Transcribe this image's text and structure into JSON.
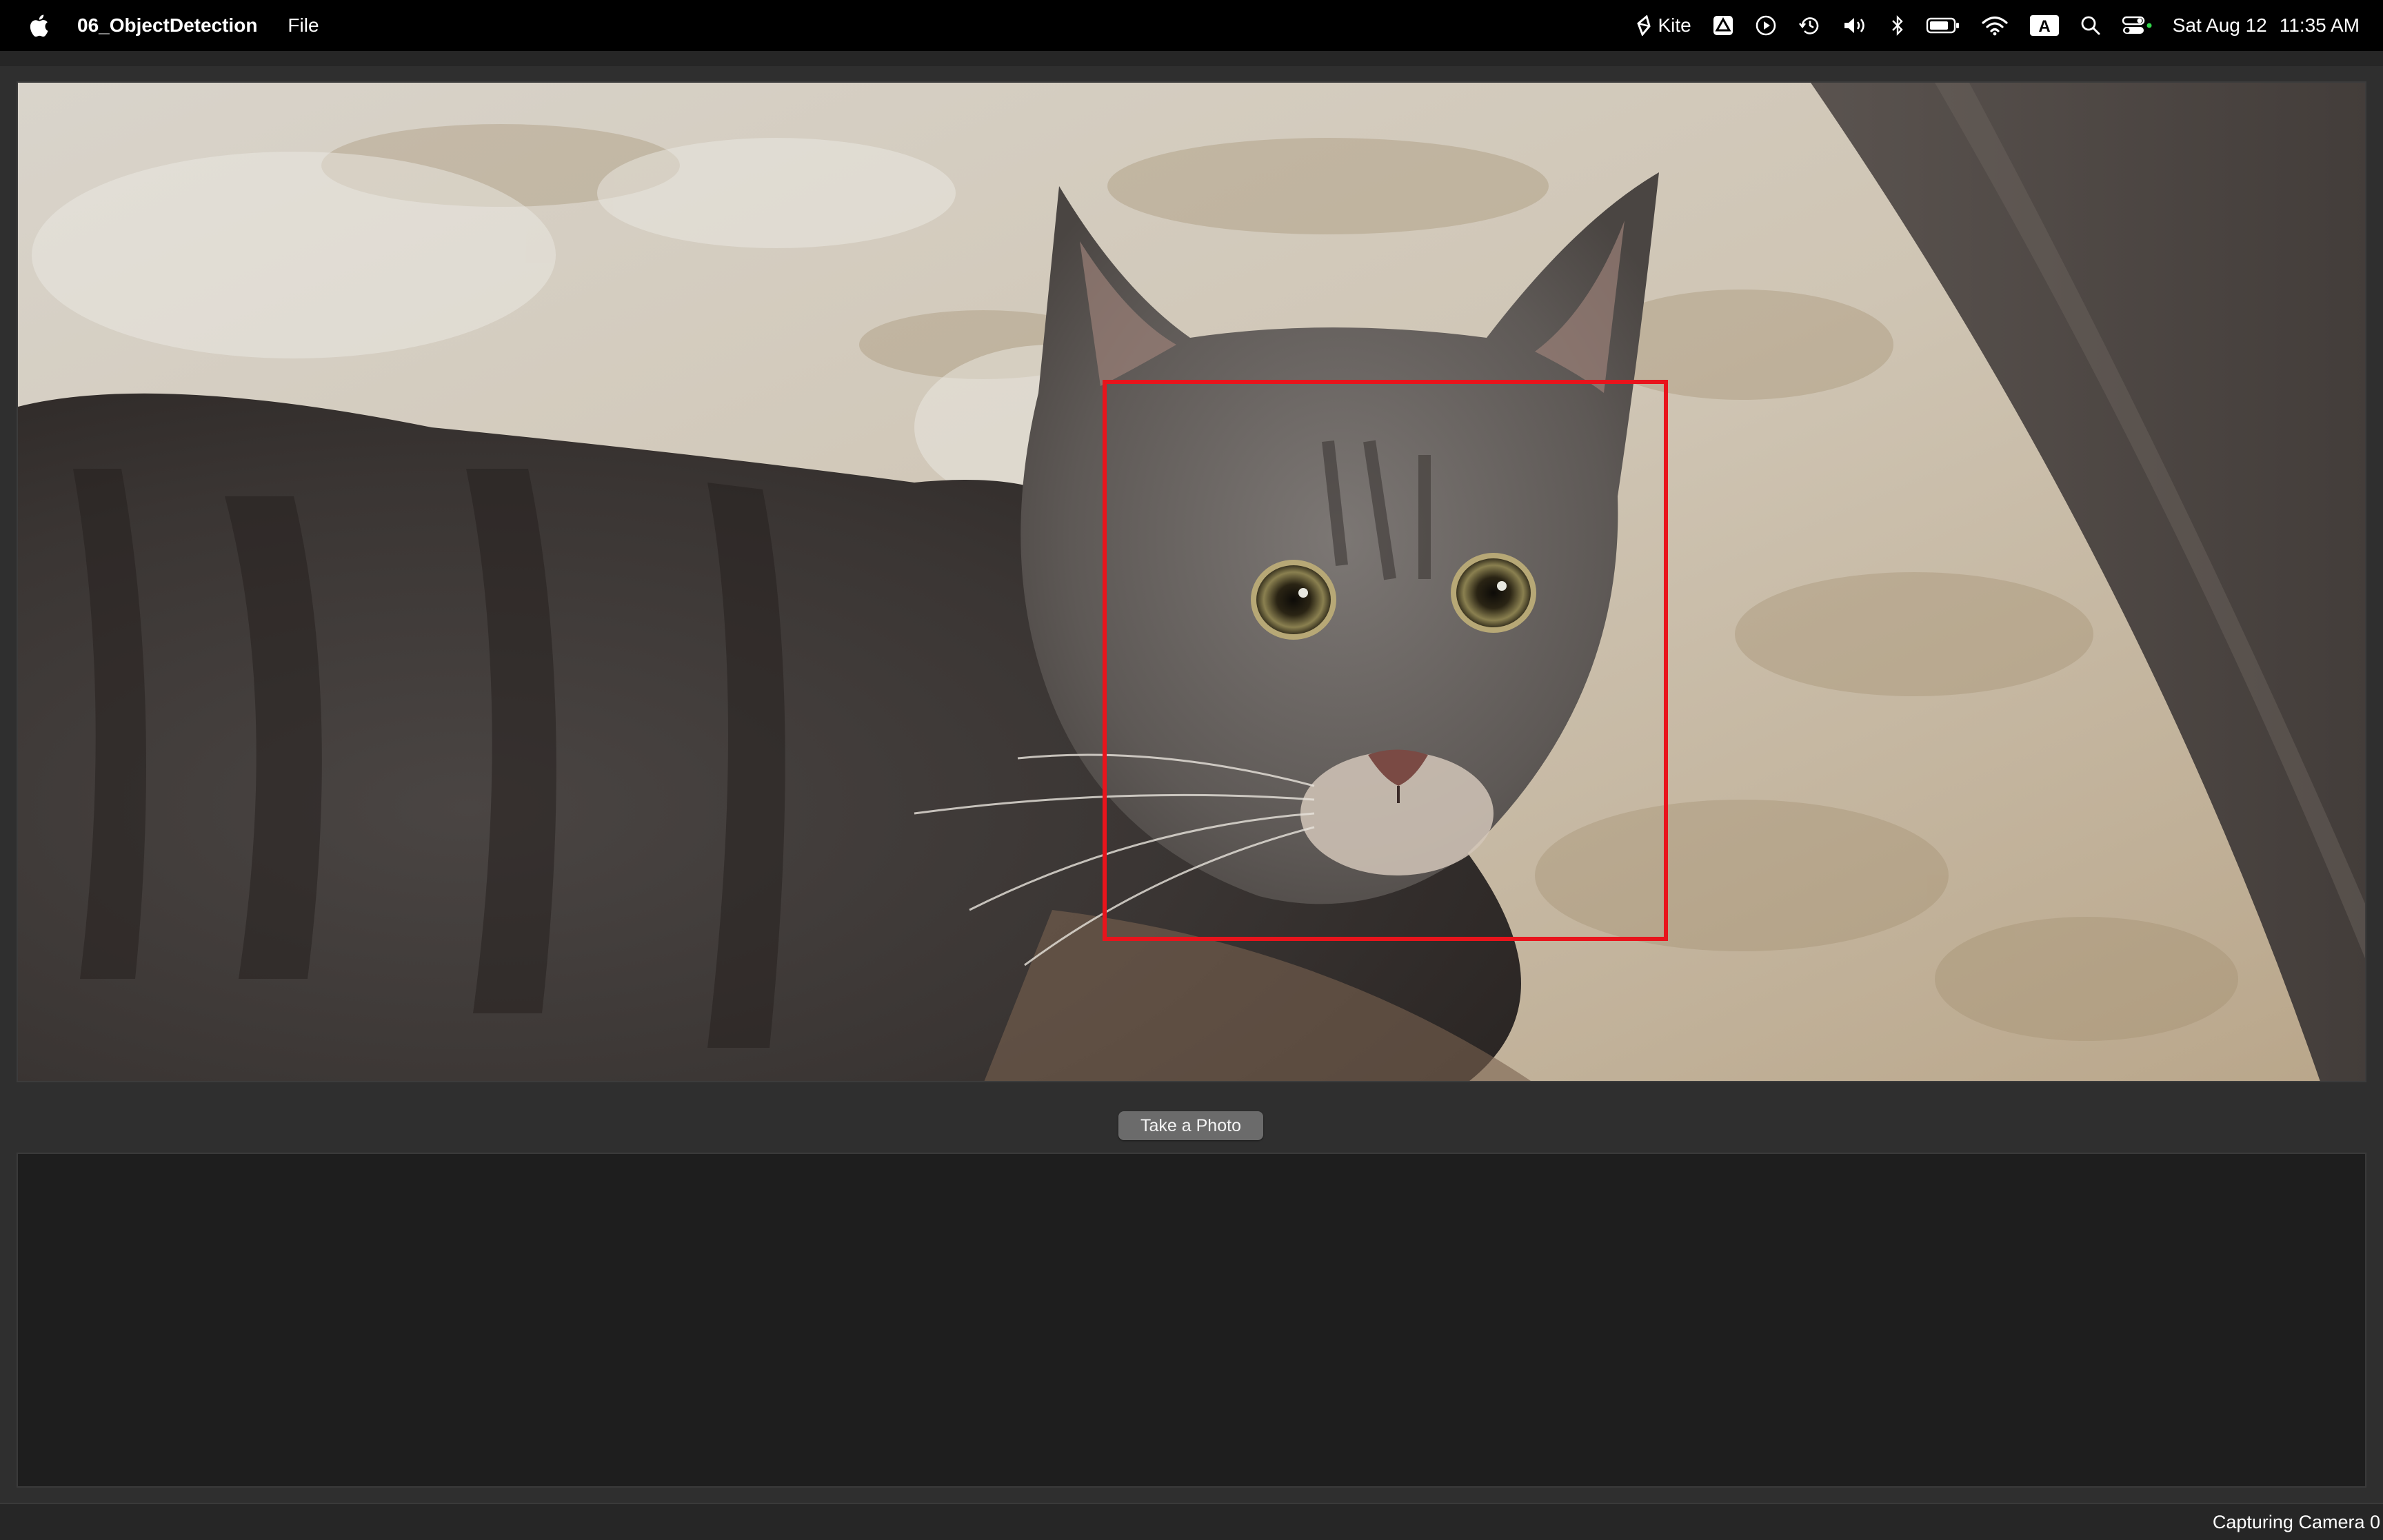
{
  "menubar": {
    "app_name": "06_ObjectDetection",
    "menus": [
      "File"
    ],
    "kite_label": "Kite",
    "input_source": "A",
    "date": "Sat Aug 12",
    "time": "11:35 AM"
  },
  "camera_view": {
    "subject": "cat",
    "detection_box_color": "#e8141c"
  },
  "controls": {
    "take_photo_label": "Take a Photo"
  },
  "status_bar": {
    "text": "Capturing Camera 0"
  },
  "colors": {
    "menubar_bg": "#000000",
    "window_bg": "#2f2f2f",
    "log_bg": "#1e1e1e",
    "button_bg": "#6b6b6b"
  },
  "icons": [
    "apple-icon",
    "kite-icon",
    "drive-icon",
    "play-icon",
    "time-machine-icon",
    "volume-icon",
    "bluetooth-icon",
    "battery-icon",
    "wifi-icon",
    "input-source-icon",
    "search-icon",
    "control-center-icon"
  ]
}
